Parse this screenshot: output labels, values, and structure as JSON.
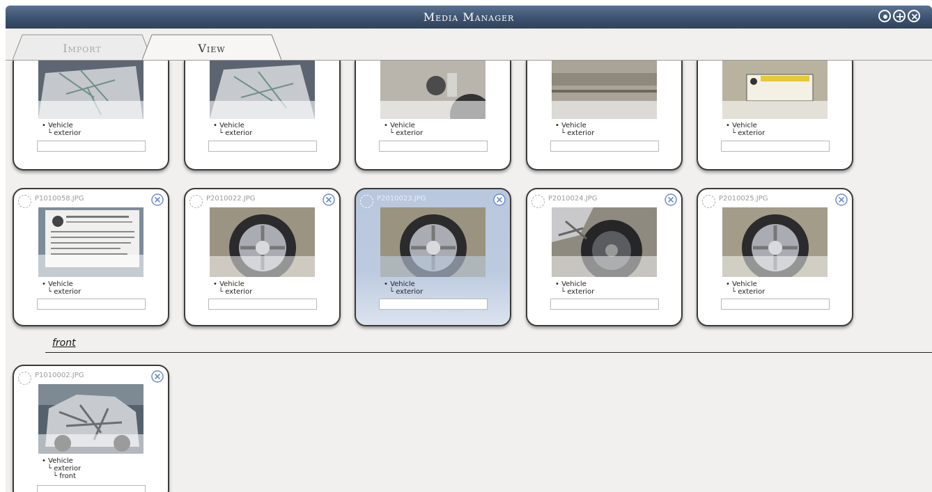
{
  "window": {
    "title": "Media Manager"
  },
  "tabs": [
    {
      "label": "Import",
      "active": false
    },
    {
      "label": "View",
      "active": true
    }
  ],
  "tag_lines": {
    "l1": "• Vehicle",
    "l2": "└ exterior",
    "l3": "└ front"
  },
  "rows": [
    {
      "cards": [
        {
          "filename": "",
          "thumb": "car-front-shattered",
          "selected": false
        },
        {
          "filename": "",
          "thumb": "car-front-shattered-2",
          "selected": false
        },
        {
          "filename": "",
          "thumb": "fuel-door",
          "selected": false
        },
        {
          "filename": "",
          "thumb": "car-side-panel",
          "selected": false
        },
        {
          "filename": "",
          "thumb": "tire-label-sticker",
          "selected": false
        }
      ]
    },
    {
      "cards": [
        {
          "filename": "P1010058.JPG",
          "thumb": "vin-label",
          "selected": false
        },
        {
          "filename": "P2010022.JPG",
          "thumb": "wheel",
          "selected": false
        },
        {
          "filename": "P2010023.JPG",
          "thumb": "wheel",
          "selected": true
        },
        {
          "filename": "P2010024.JPG",
          "thumb": "damaged-wheel",
          "selected": false
        },
        {
          "filename": "P2010025.JPG",
          "thumb": "wheel",
          "selected": false
        }
      ]
    }
  ],
  "sections": [
    {
      "label": "front",
      "cards": [
        {
          "filename": "P1010002.JPG",
          "thumb": "crashed-car-front",
          "selected": false
        }
      ]
    }
  ],
  "colors": {
    "titlebar": "#3c526e",
    "selected_card": "#b9c8de",
    "background": "#f1f0ee"
  }
}
